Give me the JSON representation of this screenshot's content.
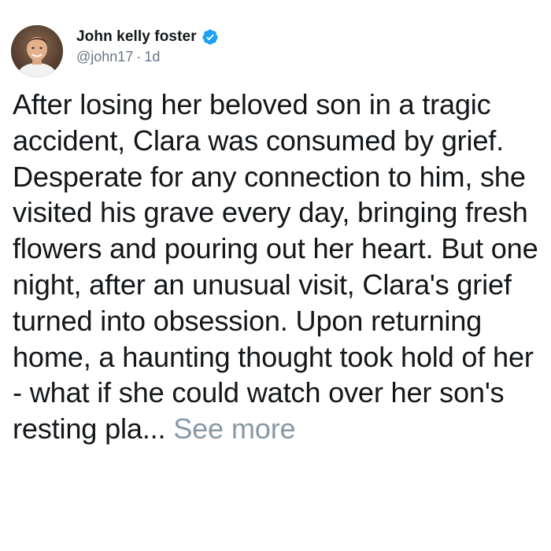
{
  "author": {
    "display_name": "John kelly foster",
    "handle": "@john17",
    "separator": "·",
    "time_ago": "1d",
    "verified": true
  },
  "tweet": {
    "text": "After losing her beloved son in a tragic accident, Clara was consumed by grief. Desperate for any connection to him, she visited his grave every day, bringing fresh flowers and pouring out her heart. But one night, after an unusual visit, Clara's grief turned into obsession. Upon returning home, a haunting thought took hold of her - what if she could watch over her son's resting pla...",
    "see_more_label": "See more"
  },
  "colors": {
    "text_primary": "#14171a",
    "text_secondary": "#657786",
    "verified_blue": "#1da1f2",
    "see_more": "#8899a6"
  }
}
